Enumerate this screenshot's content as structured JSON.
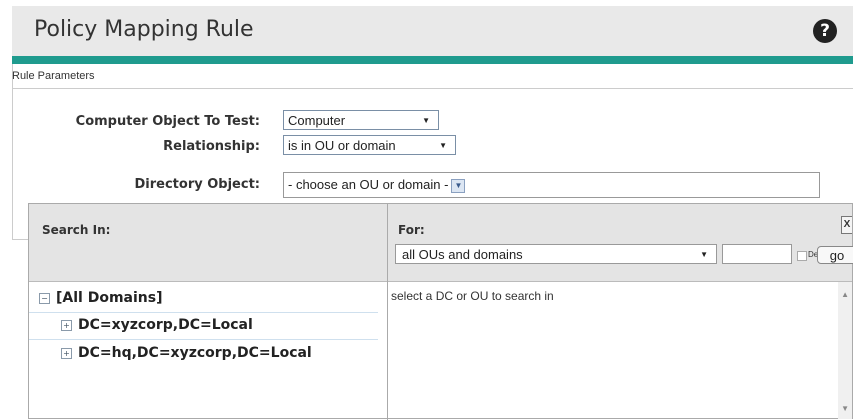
{
  "header": {
    "title": "Policy Mapping Rule"
  },
  "section": {
    "label": "Rule Parameters"
  },
  "form": {
    "computer_object": {
      "label": "Computer Object To Test:",
      "value": "Computer"
    },
    "relationship": {
      "label": "Relationship:",
      "value": "is in OU or domain"
    },
    "directory_object": {
      "label": "Directory Object:",
      "value": "- choose an OU or domain -"
    }
  },
  "popup": {
    "search_in_label": "Search In:",
    "for_label": "For:",
    "for_value": "all OUs and domains",
    "deep_label": "Deep",
    "go_label": "go",
    "tree": [
      {
        "label": "[All Domains]",
        "expander": "−"
      },
      {
        "label": "DC=xyzcorp,DC=Local",
        "expander": "+"
      },
      {
        "label": "DC=hq,DC=xyzcorp,DC=Local",
        "expander": "+"
      }
    ],
    "results_message": "select a DC or OU to search in"
  },
  "icons": {
    "help": "?",
    "close": "X",
    "arrow": "▼"
  }
}
